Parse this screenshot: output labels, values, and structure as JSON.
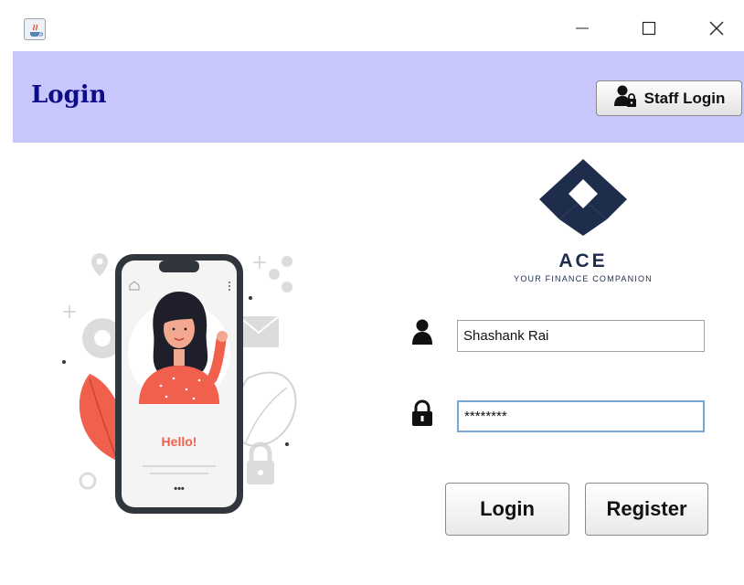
{
  "window": {
    "minimize_glyph": "—",
    "maximize_glyph": "☐",
    "close_glyph": "✕"
  },
  "header": {
    "title": "Login",
    "staff_login_label": "Staff Login",
    "background": "#c7c7fc",
    "title_color": "#0d0d8a"
  },
  "brand": {
    "name": "ACE",
    "tagline": "YOUR FINANCE COMPANION",
    "color": "#1f2d4d"
  },
  "illustration": {
    "greeting": "Hello!",
    "menu_dots": "•••",
    "accent": "#f0604d"
  },
  "form": {
    "username_value": "Shashank Rai",
    "password_value": "********",
    "login_label": "Login",
    "register_label": "Register"
  },
  "icons": {
    "app": "java-icon",
    "staff": "user-lock-icon",
    "user": "user-icon",
    "lock": "lock-icon"
  }
}
